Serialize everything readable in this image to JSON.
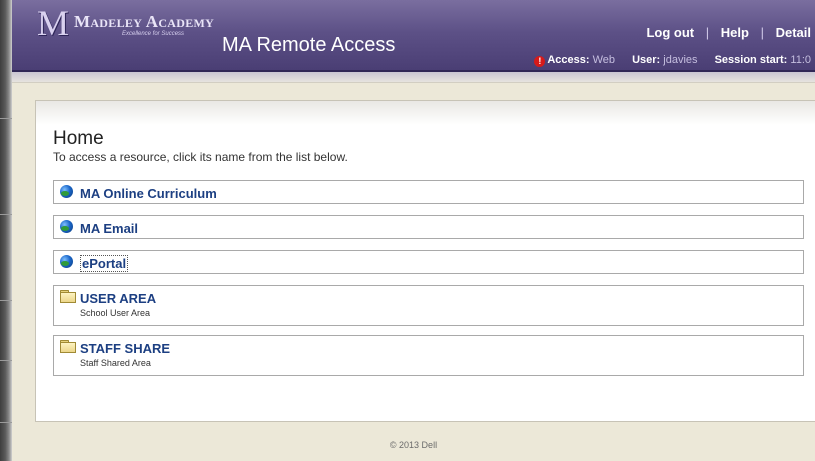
{
  "header": {
    "logo_mark": "M",
    "logo_name": "Madeley Academy",
    "logo_tagline": "Excellence for Success",
    "app_title": "MA Remote Access",
    "links": {
      "logout": "Log out",
      "help": "Help",
      "details": "Detail",
      "separator": "|"
    },
    "status": {
      "access_label": "Access:",
      "access_value": "Web",
      "user_label": "User:",
      "user_value": "jdavies",
      "session_label": "Session start:",
      "session_value": "11:0"
    }
  },
  "main": {
    "title": "Home",
    "subtitle": "To access a resource, click its name from the list below.",
    "resources": [
      {
        "name": "MA Online Curriculum",
        "icon": "globe-icon"
      },
      {
        "name": "MA Email",
        "icon": "globe-icon"
      },
      {
        "name": "ePortal",
        "icon": "globe-icon"
      },
      {
        "name": "USER AREA",
        "desc": "School User Area",
        "icon": "folder-icon"
      },
      {
        "name": "STAFF SHARE",
        "desc": "Staff Shared Area",
        "icon": "folder-icon"
      }
    ]
  },
  "footer": {
    "copyright": "© 2013 Dell"
  },
  "colors": {
    "header": "#5d5187",
    "link": "#1c3f82",
    "warning": "#d61a1a"
  }
}
